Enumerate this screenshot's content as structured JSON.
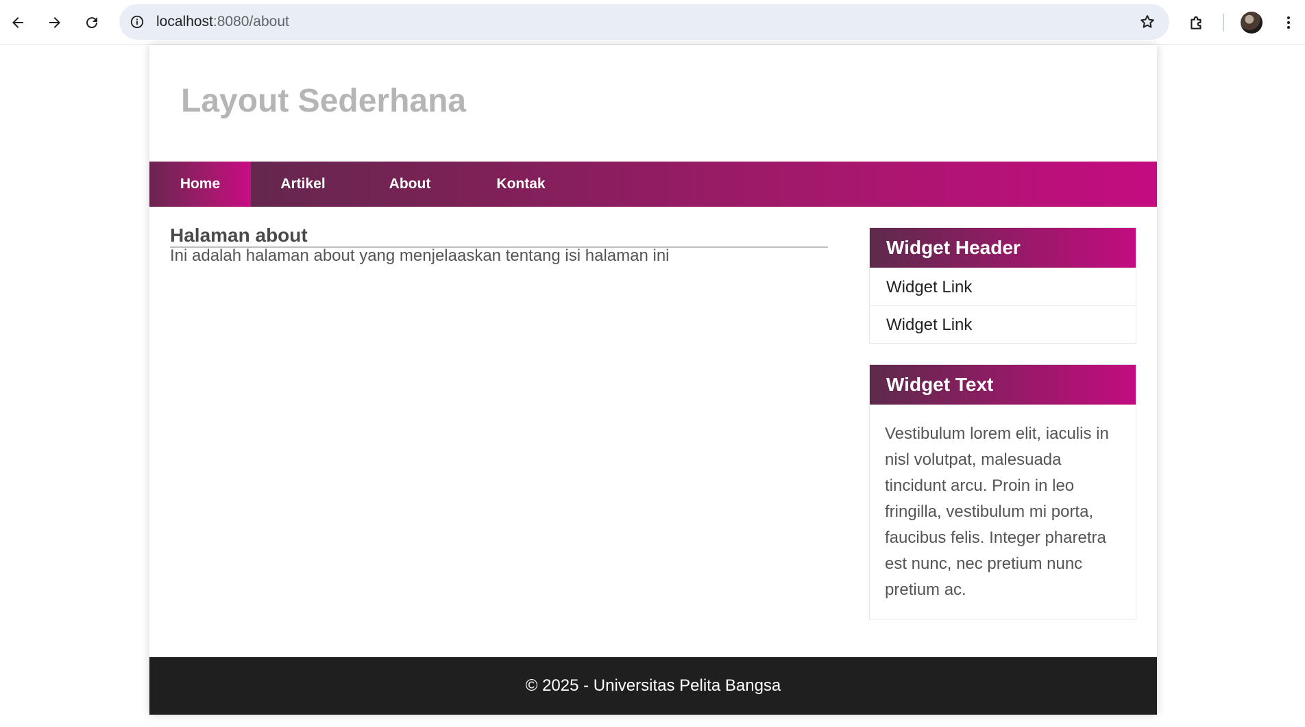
{
  "browser": {
    "url_host": "localhost",
    "url_path": ":8080/about",
    "icons": {
      "back": "arrow-left-icon",
      "forward": "arrow-right-icon",
      "reload": "reload-icon",
      "site_info": "info-icon",
      "bookmark": "star-icon",
      "extensions": "puzzle-icon",
      "profile": "avatar",
      "menu": "more-vertical-icon"
    }
  },
  "site": {
    "title": "Layout Sederhana",
    "nav": [
      {
        "label": "Home",
        "active": true
      },
      {
        "label": "Artikel",
        "active": false
      },
      {
        "label": "About",
        "active": false
      },
      {
        "label": "Kontak",
        "active": false
      }
    ]
  },
  "content": {
    "heading": "Halaman about",
    "text": "Ini adalah halaman about yang menjelaaskan tentang isi halaman ini"
  },
  "sidebar": {
    "widget_links": {
      "header": "Widget Header",
      "links": [
        "Widget Link",
        "Widget Link"
      ]
    },
    "widget_text": {
      "header": "Widget Text",
      "body": "Vestibulum lorem elit, iaculis in nisl volutpat, malesuada tincidunt arcu. Proin in leo fringilla, vestibulum mi porta, faucibus felis. Integer pharetra est nunc, nec pretium nunc pretium ac."
    }
  },
  "footer": {
    "text": "© 2025 - Universitas Pelita Bangsa"
  },
  "colors": {
    "nav_gradient_start": "#5a2a4a",
    "nav_gradient_end": "#c40c80",
    "footer_bg": "#1f1f1f",
    "title_gray": "#b5b5b5"
  }
}
